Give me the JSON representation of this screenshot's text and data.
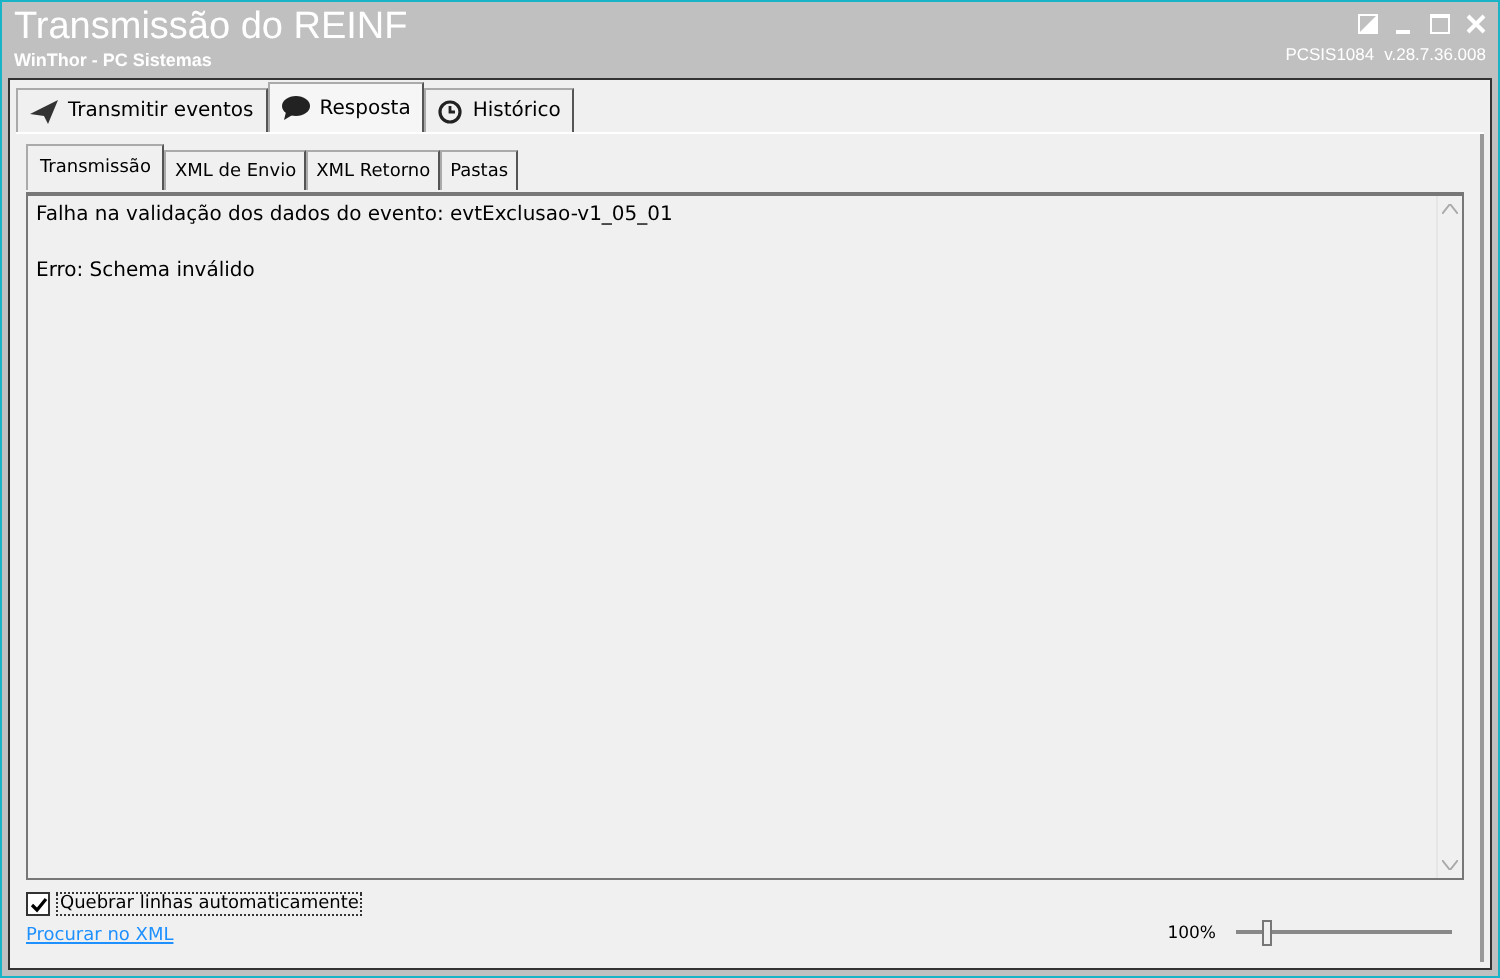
{
  "window": {
    "title": "Transmissão do REINF",
    "subtitle": "WinThor - PC Sistemas",
    "program_code": "PCSIS1084",
    "version": "v.28.7.36.008"
  },
  "tabs": [
    {
      "label": "Transmitir eventos",
      "kind": "send",
      "selected": false
    },
    {
      "label": "Resposta",
      "kind": "chat",
      "selected": true
    },
    {
      "label": "Histórico",
      "kind": "clock",
      "selected": false
    }
  ],
  "subtabs": [
    {
      "label": "Transmissão",
      "selected": true
    },
    {
      "label": "XML de Envio",
      "selected": false
    },
    {
      "label": "XML Retorno",
      "selected": false
    },
    {
      "label": "Pastas",
      "selected": false
    }
  ],
  "response_lines": [
    "Falha na validação dos dados do evento: evtExclusao-v1_05_01",
    "Erro: Schema inválido"
  ],
  "wrap_lines": {
    "label": "Quebrar linhas automaticamente",
    "checked": true
  },
  "search_link": "Procurar no XML",
  "zoom": {
    "reading": "100%",
    "level": 0.14
  }
}
